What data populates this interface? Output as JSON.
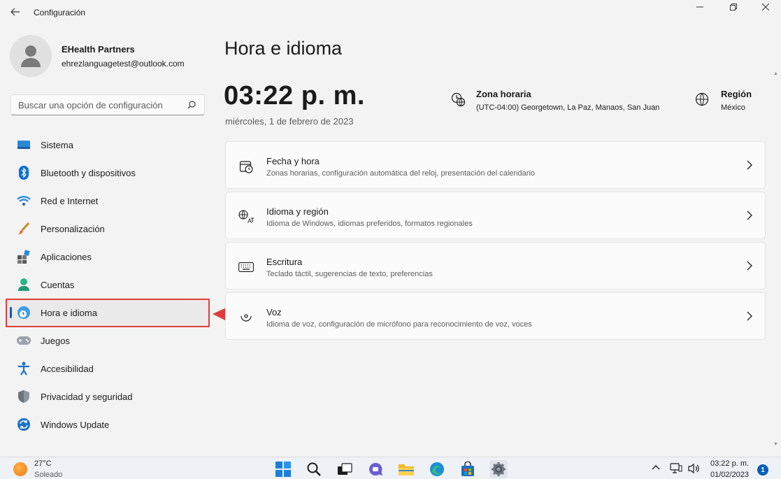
{
  "window": {
    "title": "Configuración"
  },
  "profile": {
    "name": "EHealth Partners",
    "email": "ehrezlanguagetest@outlook.com"
  },
  "search": {
    "placeholder": "Buscar una opción de configuración"
  },
  "sidebar": {
    "items": [
      {
        "label": "Sistema",
        "icon": "monitor-icon"
      },
      {
        "label": "Bluetooth y dispositivos",
        "icon": "bluetooth-icon"
      },
      {
        "label": "Red e Internet",
        "icon": "wifi-icon"
      },
      {
        "label": "Personalización",
        "icon": "brush-icon"
      },
      {
        "label": "Aplicaciones",
        "icon": "apps-icon"
      },
      {
        "label": "Cuentas",
        "icon": "person-icon"
      },
      {
        "label": "Hora e idioma",
        "icon": "globe-clock-icon",
        "active": true
      },
      {
        "label": "Juegos",
        "icon": "gamepad-icon"
      },
      {
        "label": "Accesibilidad",
        "icon": "accessibility-icon"
      },
      {
        "label": "Privacidad y seguridad",
        "icon": "shield-icon"
      },
      {
        "label": "Windows Update",
        "icon": "update-icon"
      }
    ]
  },
  "main": {
    "title": "Hora e idioma",
    "time": "03:22 p. m.",
    "date": "miércoles, 1 de febrero de 2023",
    "timezone": {
      "label": "Zona horaria",
      "value": "(UTC-04:00) Georgetown, La Paz, Manaos, San Juan"
    },
    "region": {
      "label": "Región",
      "value": "México"
    },
    "cards": [
      {
        "title": "Fecha y hora",
        "desc": "Zonas horarias, configuración automática del reloj, presentación del calendario",
        "icon": "calendar-clock-icon"
      },
      {
        "title": "Idioma y región",
        "desc": "Idioma de Windows, idiomas preferidos, formatos regionales",
        "icon": "language-icon"
      },
      {
        "title": "Escritura",
        "desc": "Teclado táctil, sugerencias de texto, preferencias",
        "icon": "keyboard-icon"
      },
      {
        "title": "Voz",
        "desc": "Idioma de voz, configuración de micrófono para reconocimiento de voz, voces",
        "icon": "microphone-icon"
      }
    ]
  },
  "taskbar": {
    "weather_temp": "27°C",
    "weather_desc": "Soleado",
    "time": "03:22 p. m.",
    "date": "01/02/2023",
    "notifications": "1"
  },
  "colors": {
    "accent": "#005fb8",
    "annotation": "#e23c3c"
  }
}
